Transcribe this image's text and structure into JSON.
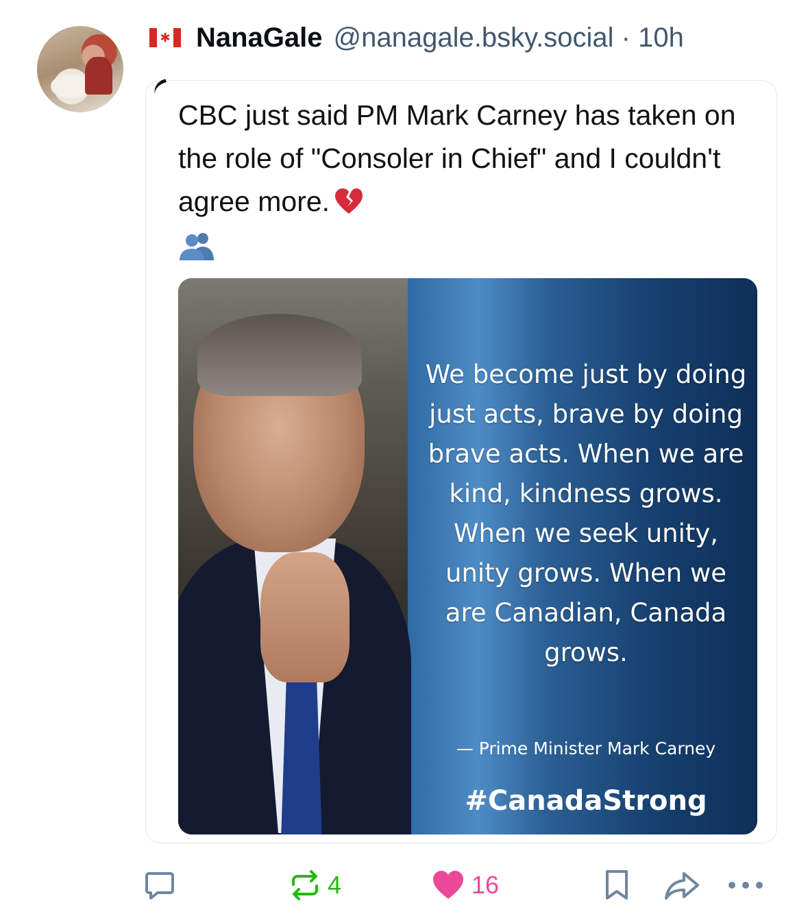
{
  "post": {
    "author_name": "NanaGale",
    "author_handle": "@nanagale.bsky.social",
    "separator": "·",
    "age": "10h",
    "flag_icon": "canada-flag-icon",
    "text": "CBC just said PM Mark Carney has taken on the role of \"Consoler in Chief\" and I couldn't agree more.",
    "emojis": [
      "broken-heart-icon",
      "busts-in-silhouette-icon"
    ]
  },
  "image": {
    "quote": "We become just by doing just acts, brave by doing brave acts. When we are kind, kindness grows. When we seek unity, unity grows. When we are Canadian, Canada grows.",
    "attribution": "— Prime Minister Mark Carney",
    "hashtag": "#CanadaStrong"
  },
  "actions": {
    "reply_count": "",
    "repost_count": "4",
    "like_count": "16",
    "colors": {
      "repost": "#20bc07",
      "like": "#ec4899",
      "default": "#6f869f"
    }
  }
}
